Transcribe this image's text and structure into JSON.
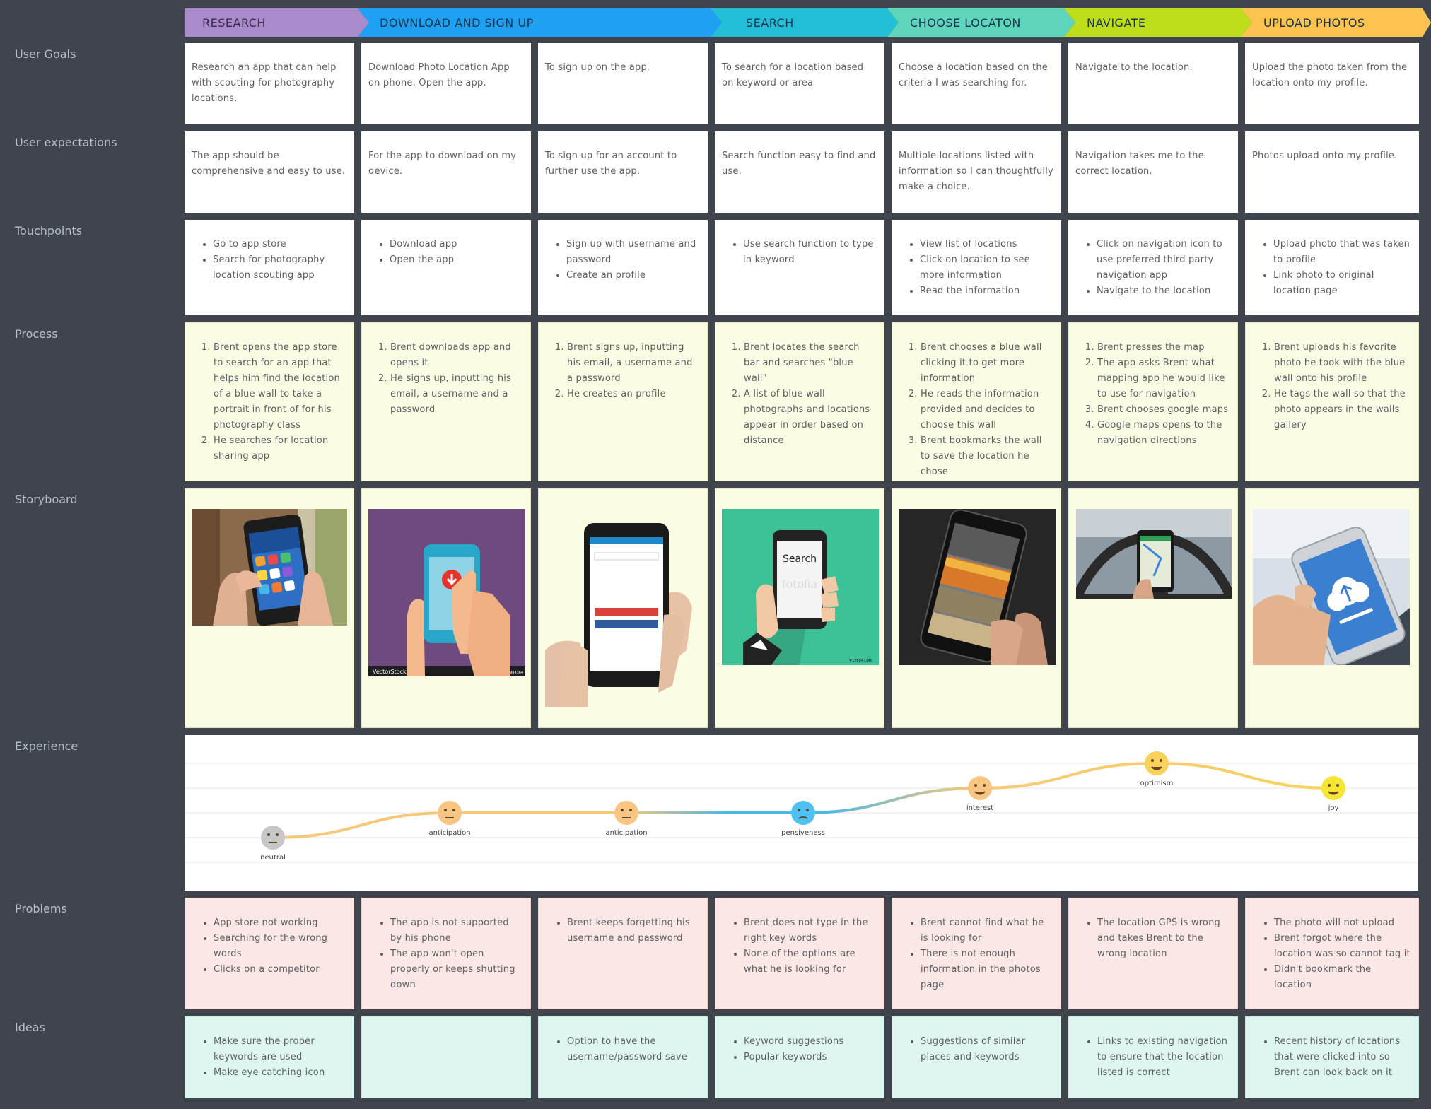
{
  "phases": [
    {
      "label": "RESEARCH",
      "color": "#a98acb"
    },
    {
      "label": "DOWNLOAD AND SIGN UP",
      "color": "#1ea1f2"
    },
    {
      "label": "SEARCH",
      "color": "#22bfd6"
    },
    {
      "label": "CHOOSE LOCATON",
      "color": "#5fd6bb"
    },
    {
      "label": "NAVIGATE",
      "color": "#bede1c"
    },
    {
      "label": "UPLOAD PHOTOS",
      "color": "#fcc34e"
    }
  ],
  "row_labels": {
    "user_goals": "User Goals",
    "user_expectations": "User expectations",
    "touchpoints": "Touchpoints",
    "process": "Process",
    "storyboard": "Storyboard",
    "experience": "Experience",
    "problems": "Problems",
    "ideas": "Ideas"
  },
  "user_goals": [
    "Research an app that can help with scouting for photography locations.",
    "Download Photo Location App on phone. Open the app.",
    "To sign up on the app.",
    "To search for a location based on keyword or area",
    "Choose a location based on the criteria I was searching for.",
    "Navigate to the location.",
    "Upload the photo taken from the location onto my profile."
  ],
  "user_expectations": [
    "The app should be comprehensive and easy to use.",
    "For the app to download on my device.",
    "To sign up for an account to further use the app.",
    "Search function easy to find and use.",
    "Multiple locations listed with information so I can thoughtfully make a choice.",
    "Navigation takes me to the correct location.",
    "Photos upload onto my profile."
  ],
  "touchpoints": [
    [
      "Go to app store",
      "Search for photography location scouting app"
    ],
    [
      "Download app",
      "Open the app"
    ],
    [
      "Sign up with username and password",
      "Create an profile"
    ],
    [
      "Use search function to type in keyword"
    ],
    [
      "View list of locations",
      "Click on location to see more information",
      "Read the information"
    ],
    [
      "Click on navigation icon to use preferred third party navigation app",
      "Navigate to the location"
    ],
    [
      "Upload photo that was taken to profile",
      "Link photo to original location page"
    ]
  ],
  "process": [
    [
      "Brent opens the app store to search for an app that helps him find the location of a blue wall to take a portrait in front of for his photography class",
      "He searches for location sharing app"
    ],
    [
      "Brent downloads app and opens it",
      "He signs up, inputting his email, a username and a password"
    ],
    [
      "Brent signs up, inputting his email, a username and a password",
      "He creates an profile"
    ],
    [
      "Brent locates the search bar and searches \"blue wall\"",
      "A list of blue wall photographs and locations appear in order based on distance"
    ],
    [
      "Brent chooses a blue wall clicking it to get more information",
      "He reads the information provided and decides to choose this wall",
      "Brent bookmarks the wall to save the location he chose"
    ],
    [
      "Brent presses the map",
      "The app asks Brent what mapping app he would like to use for navigation",
      "Brent chooses google maps",
      "Google maps opens to the navigation directions"
    ],
    [
      "Brent uploads his favorite photo he took with the blue wall onto his profile",
      "He tags the wall so that the photo appears in the walls gallery"
    ]
  ],
  "storyboard": {
    "images": [
      "hand-holding-phone-app-store-photo",
      "download-app-illustration",
      "hand-holding-phone-signup-photo",
      "search-phone-illustration",
      "phone-photo-gallery-photo",
      "phone-navigation-in-car-photo",
      "phone-cloud-upload-photo"
    ],
    "vectorstock_text": "VectorStock",
    "vectorstock_url": "VectorStock.com/18984364",
    "search_text": "Search",
    "search_watermark": "fotolia",
    "search_code": "#168847340"
  },
  "experience": {
    "emotions": [
      {
        "label": "neutral",
        "level": 0,
        "face": "neutral-face-icon",
        "color": "#c7c7c7"
      },
      {
        "label": "anticipation",
        "level": 1,
        "face": "skeptical-face-icon",
        "color": "#f9c582"
      },
      {
        "label": "anticipation",
        "level": 1,
        "face": "skeptical-face-icon",
        "color": "#f9c582"
      },
      {
        "label": "pensiveness",
        "level": 1,
        "face": "worried-face-icon",
        "color": "#4fc0f3"
      },
      {
        "label": "interest",
        "level": 2,
        "face": "smile-face-icon",
        "color": "#f9c582"
      },
      {
        "label": "optimism",
        "level": 3,
        "face": "grin-face-icon",
        "color": "#f8d25a"
      },
      {
        "label": "joy",
        "level": 2,
        "face": "happy-face-icon",
        "color": "#f7e536"
      }
    ]
  },
  "problems": [
    [
      "App store not working",
      "Searching for the wrong words",
      "Clicks on a competitor"
    ],
    [
      "The app is not supported by his phone",
      "The app won't open properly or keeps shutting down"
    ],
    [
      "Brent keeps forgetting his username and password"
    ],
    [
      "Brent does not type in the right key words",
      "None of the options are what he is looking for"
    ],
    [
      "Brent cannot find what he is looking for",
      "There is not enough information in the photos page"
    ],
    [
      "The location GPS is wrong and takes Brent to the wrong location"
    ],
    [
      "The photo will not upload",
      "Brent forgot where the location was so cannot tag it",
      "Didn't bookmark the location"
    ]
  ],
  "ideas": [
    [
      "Make sure the proper keywords are used",
      "Make eye catching icon"
    ],
    [],
    [
      "Option to have the username/password save"
    ],
    [
      "Keyword suggestions",
      "Popular keywords"
    ],
    [
      "Suggestions of similar places and keywords"
    ],
    [
      "Links to existing navigation to ensure that the location listed is correct"
    ],
    [
      "Recent history of locations that were clicked into so Brent can look back on it"
    ]
  ]
}
